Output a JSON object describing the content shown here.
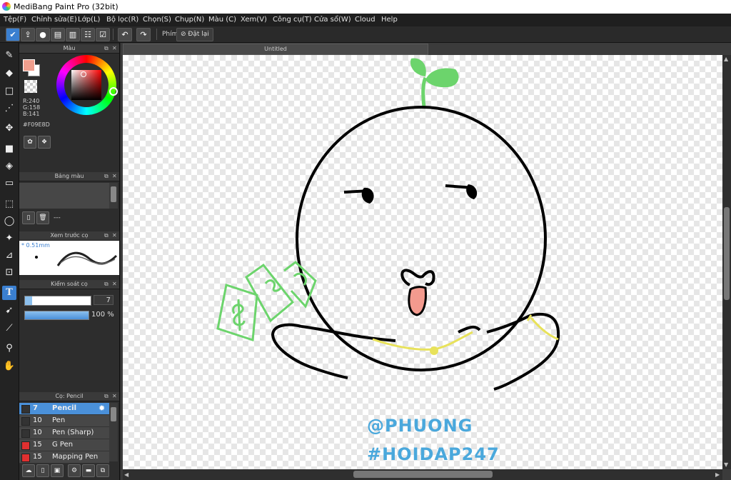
{
  "window": {
    "title": "MediBang Paint Pro (32bit)"
  },
  "menu": [
    "Tệp(F)",
    "Chỉnh sửa(E)",
    "Lớp(L)",
    "Bộ lọc(R)",
    "Chọn(S)",
    "Chụp(N)",
    "Màu (C)",
    "Xem(V)",
    "Công cụ(T)",
    "Cửa sổ(W)",
    "Cloud",
    "Help"
  ],
  "toolbar": {
    "shortcut_label": "Phím",
    "reset_label": "Đặt lại"
  },
  "panels": {
    "color": {
      "title": "Màu",
      "r": "R:240",
      "g": "G:158",
      "b": "B:141",
      "hex": "#F09E8D",
      "fg_color": "#F09E8D",
      "bg_color": "#FFFFFF"
    },
    "palette": {
      "title": "Bảng màu",
      "empty_text": "---"
    },
    "brush_preview": {
      "title": "Xem trước cọ",
      "size": "* 0.51mm"
    },
    "brush_control": {
      "title": "Kiểm soát cọ",
      "size_value": "7",
      "opacity_value": "100 %",
      "size_fraction": 0.11,
      "opacity_percent": 100
    },
    "brushes": {
      "title": "Cọ: Pencil",
      "items": [
        {
          "size": "7",
          "name": "Pencil",
          "color": "#333333",
          "selected": true
        },
        {
          "size": "10",
          "name": "Pen",
          "color": "#333333",
          "selected": false
        },
        {
          "size": "10",
          "name": "Pen (Sharp)",
          "color": "#333333",
          "selected": false
        },
        {
          "size": "15",
          "name": "G Pen",
          "color": "#e03030",
          "selected": false
        },
        {
          "size": "15",
          "name": "Mapping Pen",
          "color": "#e03030",
          "selected": false
        }
      ]
    }
  },
  "document": {
    "tab_title": "Untitled"
  },
  "canvas_text": {
    "line1": "@PHUONG",
    "line2": "#HOIDAP247"
  },
  "icons": {
    "tools": [
      "brush-icon",
      "eraser-icon",
      "rectangle-icon",
      "dot-icon",
      "move-icon",
      "fill-rect-icon",
      "bucket-icon",
      "gradient-icon",
      "select-rect-icon",
      "lasso-icon",
      "magic-wand-icon",
      "select-pen-icon",
      "select-eraser-icon",
      "text-icon",
      "operation-icon",
      "divide-icon",
      "eyedropper-icon",
      "hand-icon"
    ]
  }
}
